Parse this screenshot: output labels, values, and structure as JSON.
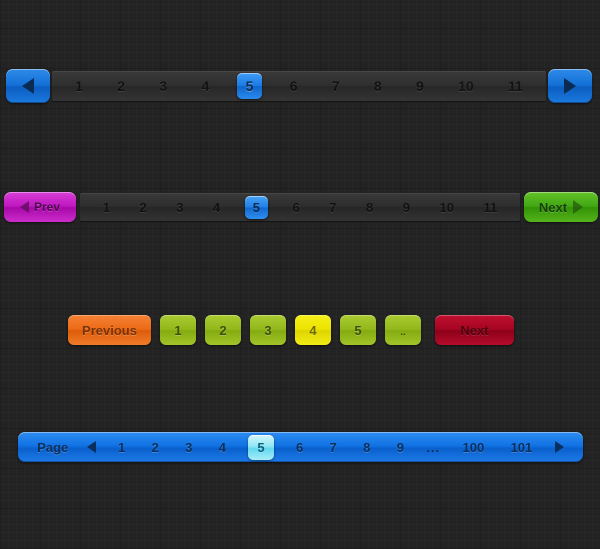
{
  "pagers": {
    "pager1": {
      "prev_icon": "triangle-left-icon",
      "next_icon": "triangle-right-icon",
      "active_page": "5",
      "accent_color": "#1472d8",
      "pages": [
        "1",
        "2",
        "3",
        "4",
        "5",
        "6",
        "7",
        "8",
        "9",
        "10",
        "11"
      ]
    },
    "pager2": {
      "prev_label": "Prev",
      "next_label": "Next",
      "prev_icon": "triangle-left-icon",
      "next_icon": "triangle-right-icon",
      "prev_color": "#bf16bf",
      "next_color": "#41a614",
      "active_page": "5",
      "pages": [
        "1",
        "2",
        "3",
        "4",
        "5",
        "6",
        "7",
        "8",
        "9",
        "10",
        "11"
      ]
    },
    "pager3": {
      "prev_label": "Previous",
      "next_label": "Next",
      "prev_color": "#ec6a16",
      "next_color": "#a50522",
      "number_color": "#92b81c",
      "active_color": "#ece200",
      "active_page": "4",
      "ellipsis_label": "..",
      "pages": [
        "1",
        "2",
        "3",
        "4",
        "5"
      ]
    },
    "pager4": {
      "label": "Page",
      "prev_icon": "triangle-left-icon",
      "next_icon": "triangle-right-icon",
      "bar_color": "#1173e4",
      "active_color": "#8fe6f5",
      "active_page": "5",
      "ellipsis_label": "...",
      "pages_before": [
        "1",
        "2",
        "3",
        "4",
        "5",
        "6",
        "7",
        "8",
        "9"
      ],
      "pages_after": [
        "100",
        "101"
      ]
    }
  }
}
